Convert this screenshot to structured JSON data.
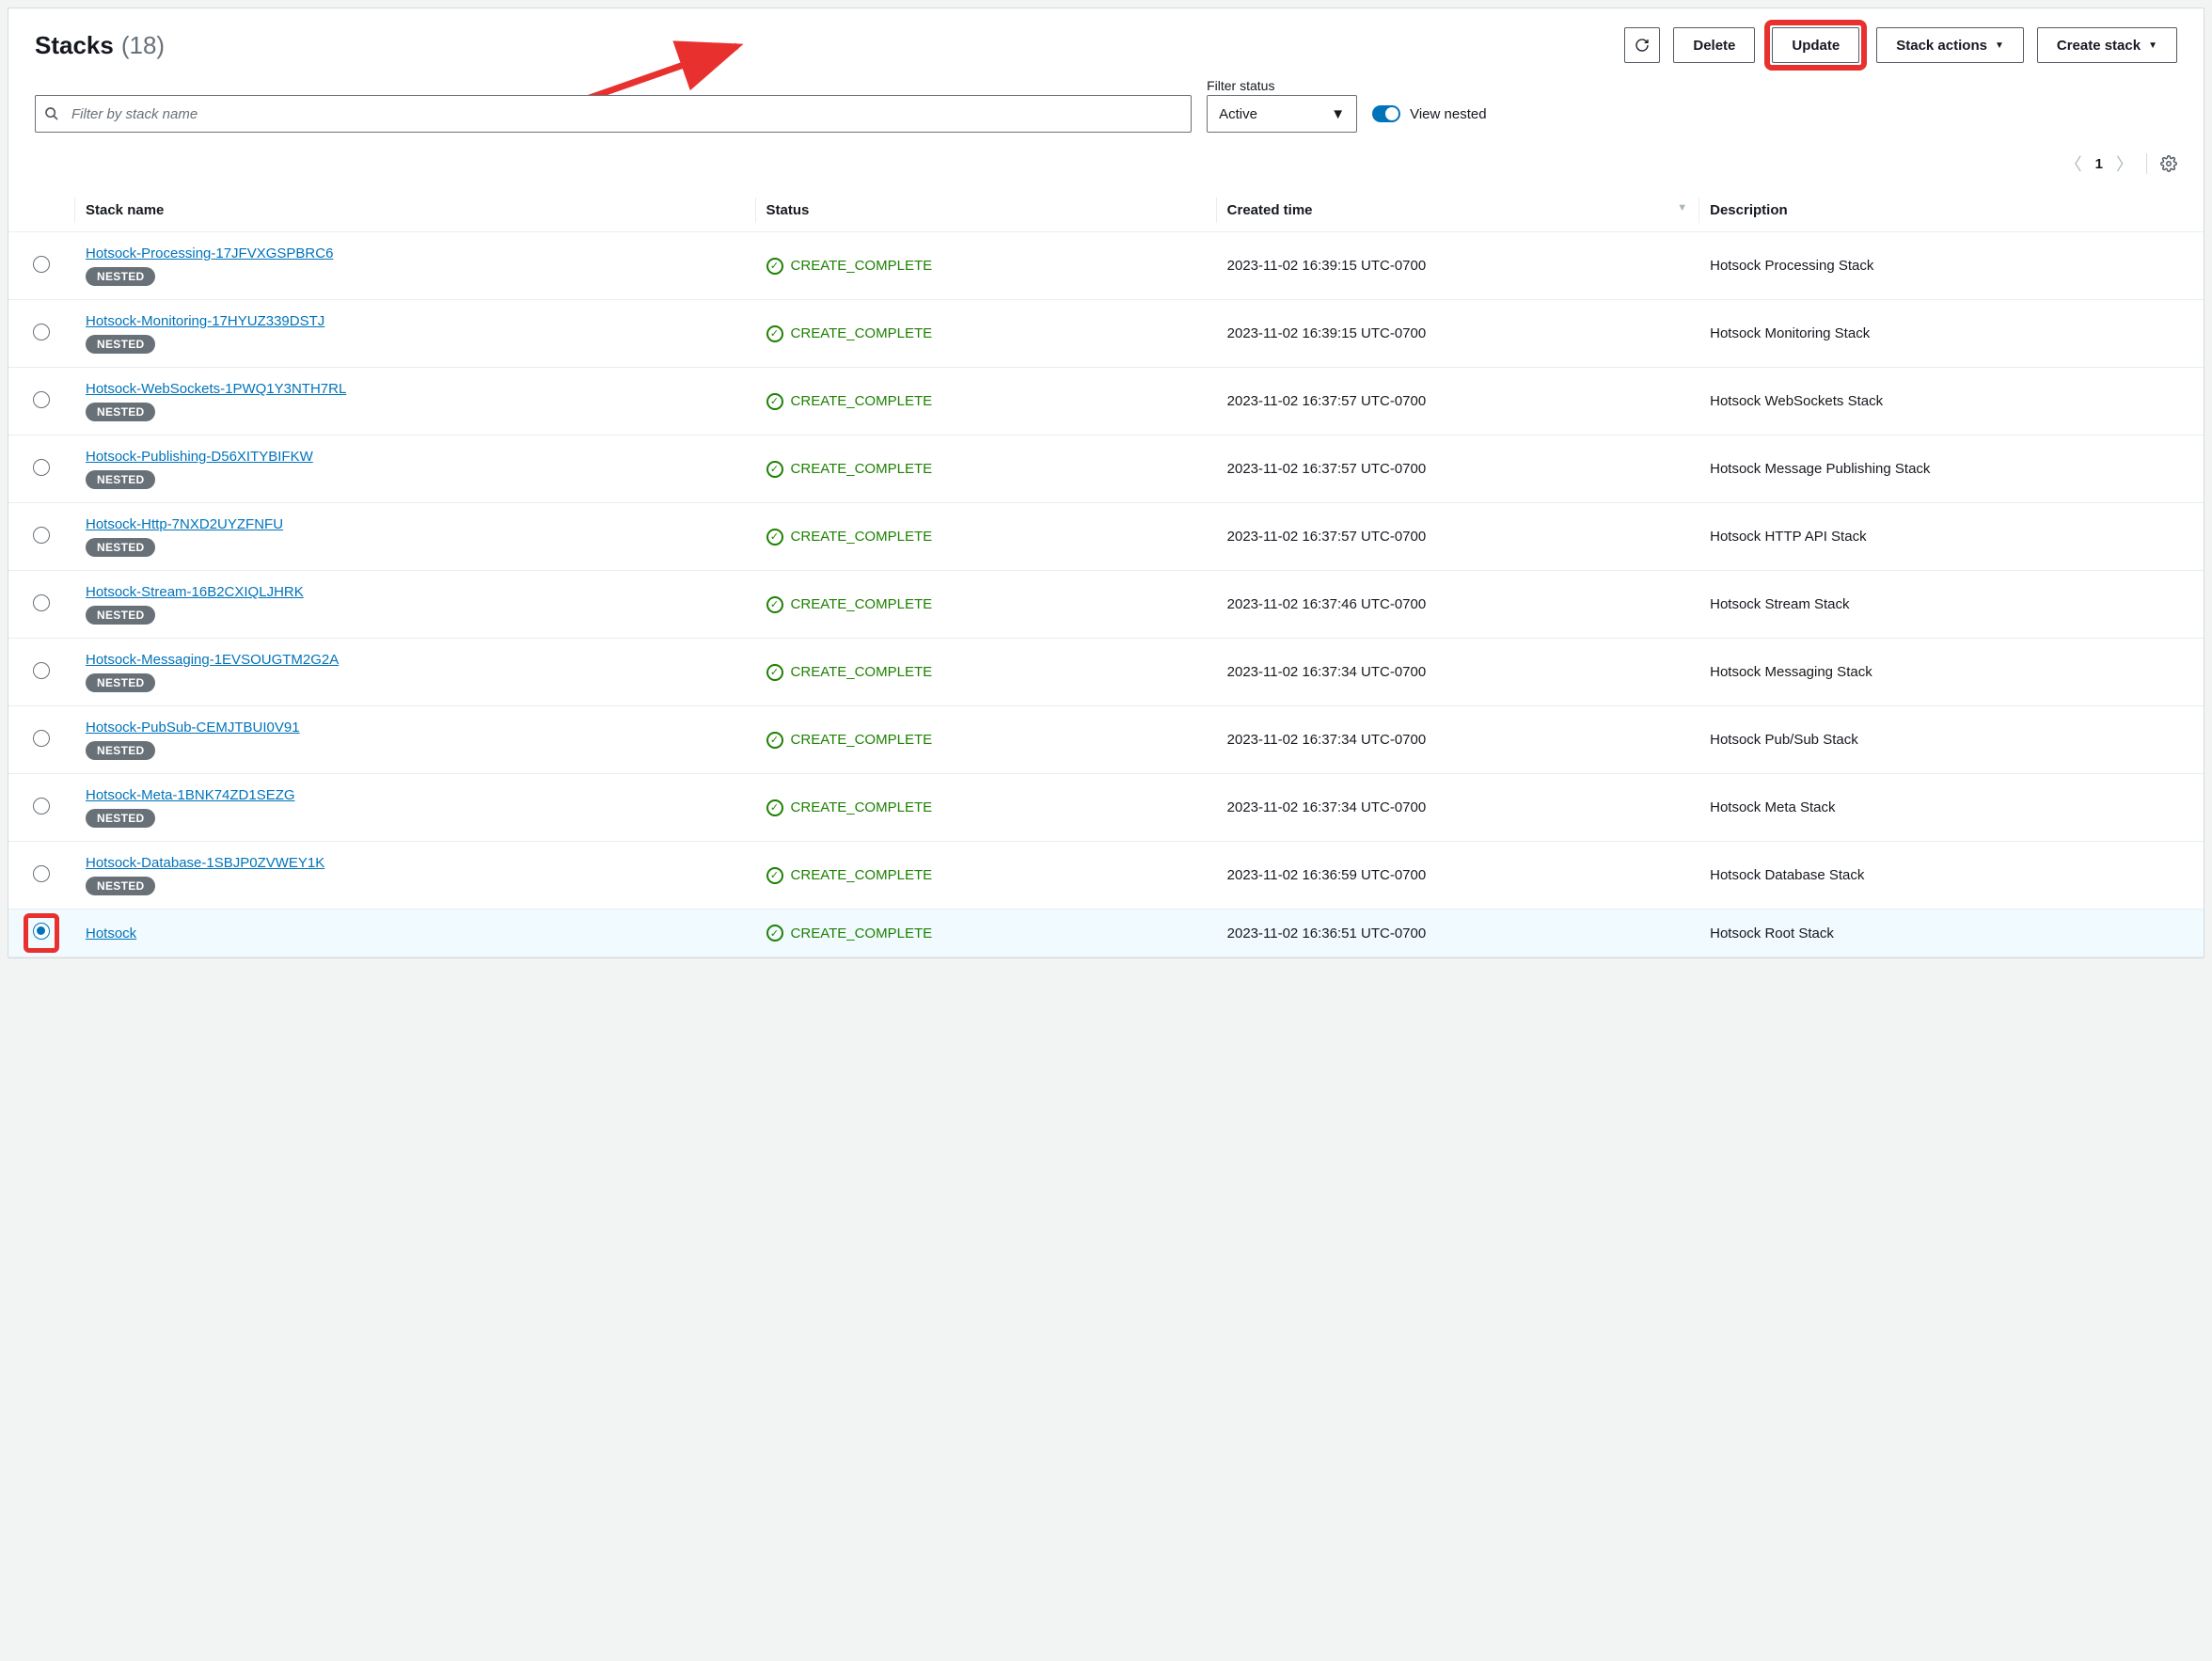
{
  "header": {
    "title": "Stacks",
    "count": "(18)"
  },
  "toolbar": {
    "delete": "Delete",
    "update": "Update",
    "stack_actions": "Stack actions",
    "create_stack": "Create stack"
  },
  "filter": {
    "search_placeholder": "Filter by stack name",
    "status_label": "Filter status",
    "status_value": "Active",
    "view_nested": "View nested"
  },
  "pagination": {
    "page": "1"
  },
  "columns": {
    "name": "Stack name",
    "status": "Status",
    "created": "Created time",
    "description": "Description"
  },
  "badge": {
    "nested": "NESTED"
  },
  "status_text": "CREATE_COMPLETE",
  "rows": [
    {
      "name": "Hotsock-Processing-17JFVXGSPBRC6",
      "nested": true,
      "created": "2023-11-02 16:39:15 UTC-0700",
      "description": "Hotsock Processing Stack",
      "selected": false
    },
    {
      "name": "Hotsock-Monitoring-17HYUZ339DSTJ",
      "nested": true,
      "created": "2023-11-02 16:39:15 UTC-0700",
      "description": "Hotsock Monitoring Stack",
      "selected": false
    },
    {
      "name": "Hotsock-WebSockets-1PWQ1Y3NTH7RL",
      "nested": true,
      "created": "2023-11-02 16:37:57 UTC-0700",
      "description": "Hotsock WebSockets Stack",
      "selected": false
    },
    {
      "name": "Hotsock-Publishing-D56XITYBIFKW",
      "nested": true,
      "created": "2023-11-02 16:37:57 UTC-0700",
      "description": "Hotsock Message Publishing Stack",
      "selected": false
    },
    {
      "name": "Hotsock-Http-7NXD2UYZFNFU",
      "nested": true,
      "created": "2023-11-02 16:37:57 UTC-0700",
      "description": "Hotsock HTTP API Stack",
      "selected": false
    },
    {
      "name": "Hotsock-Stream-16B2CXIQLJHRK",
      "nested": true,
      "created": "2023-11-02 16:37:46 UTC-0700",
      "description": "Hotsock Stream Stack",
      "selected": false
    },
    {
      "name": "Hotsock-Messaging-1EVSOUGTM2G2A",
      "nested": true,
      "created": "2023-11-02 16:37:34 UTC-0700",
      "description": "Hotsock Messaging Stack",
      "selected": false
    },
    {
      "name": "Hotsock-PubSub-CEMJTBUI0V91",
      "nested": true,
      "created": "2023-11-02 16:37:34 UTC-0700",
      "description": "Hotsock Pub/Sub Stack",
      "selected": false
    },
    {
      "name": "Hotsock-Meta-1BNK74ZD1SEZG",
      "nested": true,
      "created": "2023-11-02 16:37:34 UTC-0700",
      "description": "Hotsock Meta Stack",
      "selected": false
    },
    {
      "name": "Hotsock-Database-1SBJP0ZVWEY1K",
      "nested": true,
      "created": "2023-11-02 16:36:59 UTC-0700",
      "description": "Hotsock Database Stack",
      "selected": false
    },
    {
      "name": "Hotsock",
      "nested": false,
      "created": "2023-11-02 16:36:51 UTC-0700",
      "description": "Hotsock Root Stack",
      "selected": true
    }
  ]
}
